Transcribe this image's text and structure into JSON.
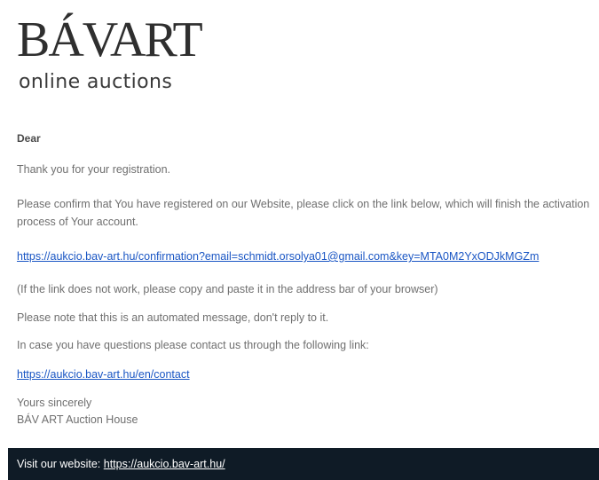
{
  "logo": {
    "brand": "BÁVART",
    "subtitle": "online auctions"
  },
  "email": {
    "greeting": "Dear",
    "thanks": "Thank you for your registration.",
    "confirm": "Please confirm that You have registered on our Website, please click on the link below, which will finish the activation process of Your account.",
    "confirmation_link": "https://aukcio.bav-art.hu/confirmation?email=schmidt.orsolya01@gmail.com&key=MTA0M2YxODJkMGZm",
    "link_help": "(If the link does not work, please copy and paste it in the address bar of your browser)",
    "automated_note": "Please note that this is an automated message, don't reply to it.",
    "questions": "In case you have questions please contact us through the following link:",
    "contact_link": "https://aukcio.bav-art.hu/en/contact",
    "closing": "Yours sincerely",
    "signature": "BÁV ART Auction House"
  },
  "footer": {
    "label": "Visit our website:",
    "link": "https://aukcio.bav-art.hu/"
  }
}
